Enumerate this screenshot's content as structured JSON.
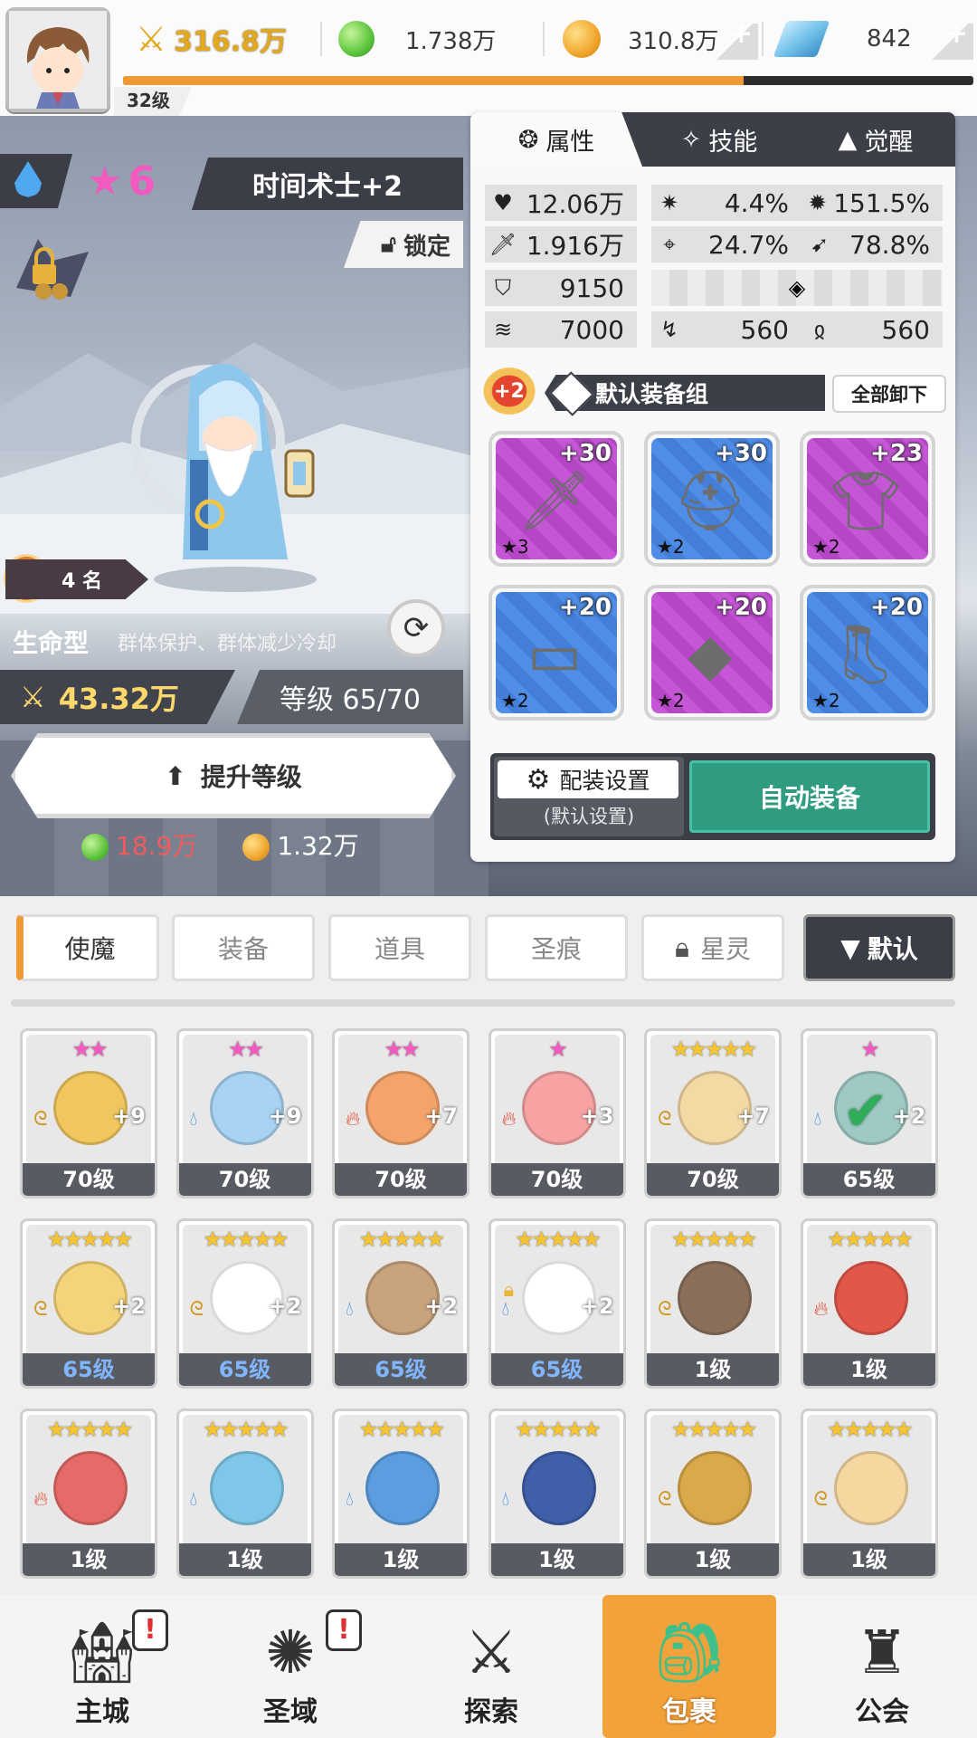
{
  "header": {
    "power": "316.8万",
    "green_currency": "1.738万",
    "gold_currency": "310.8万",
    "gem_currency": "842",
    "player_level": "32级",
    "xp_progress": 0.73
  },
  "hero": {
    "stars": "6",
    "name": "时间术士+2",
    "lock_label": "锁定",
    "hot_icon": "热",
    "hot_rank": "4 名",
    "type": "生命型",
    "type_desc": "群体保护、群体减少冷却",
    "power": "43.32万",
    "level": "等级 65/70",
    "upgrade_label": "提升等级",
    "cost_green": "18.9万",
    "cost_gold": "1.32万"
  },
  "panel": {
    "tabs": [
      "属性",
      "技能",
      "觉醒"
    ],
    "stats": {
      "hp": "12.06万",
      "crit": "4.4%",
      "crit_dmg": "151.5%",
      "atk": "1.916万",
      "acc": "24.7%",
      "dodge": "78.8%",
      "def": "9150",
      "spd": "7000",
      "res1": "560",
      "res2": "560"
    },
    "equip_plus": "+2",
    "equip_set_name": "默认装备组",
    "unequip_label": "全部卸下",
    "equipment": [
      {
        "level": "+30",
        "stars": "★3",
        "rarity": "purple",
        "icon": "sword-icon"
      },
      {
        "level": "+30",
        "stars": "★2",
        "rarity": "blue",
        "icon": "helmet-icon"
      },
      {
        "level": "+23",
        "stars": "★2",
        "rarity": "purple",
        "icon": "armor-icon"
      },
      {
        "level": "+20",
        "stars": "★2",
        "rarity": "blue",
        "icon": "belt-icon"
      },
      {
        "level": "+20",
        "stars": "★2",
        "rarity": "purple",
        "icon": "necklace-icon"
      },
      {
        "level": "+20",
        "stars": "★2",
        "rarity": "blue",
        "icon": "boots-icon"
      }
    ],
    "loadout_label": "配装设置",
    "loadout_sub": "(默认设置)",
    "auto_equip_label": "自动装备"
  },
  "inventory": {
    "tabs": [
      "使魔",
      "装备",
      "道具",
      "圣痕",
      "星灵"
    ],
    "sort_label": "默认",
    "heroes": [
      {
        "stars": "★★",
        "level": "70级",
        "plus": "+9",
        "elem": "wind"
      },
      {
        "stars": "★★",
        "level": "70级",
        "plus": "+9",
        "elem": "water"
      },
      {
        "stars": "★★",
        "level": "70级",
        "plus": "+7",
        "elem": "fire"
      },
      {
        "stars": "★",
        "level": "70级",
        "plus": "+3",
        "elem": "fire"
      },
      {
        "stars": "★★★★★",
        "level": "70级",
        "plus": "+7",
        "elem": "wind"
      },
      {
        "stars": "★",
        "level": "65级",
        "plus": "+2",
        "elem": "water"
      },
      {
        "stars": "★★★★★",
        "level": "65级",
        "plus": "+2",
        "elem": "wind"
      },
      {
        "stars": "★★★★★",
        "level": "65级",
        "plus": "+2",
        "elem": "wind"
      },
      {
        "stars": "★★★★★",
        "level": "65级",
        "plus": "+2",
        "elem": "water"
      },
      {
        "stars": "★★★★★",
        "level": "65级",
        "plus": "+2",
        "elem": "water"
      },
      {
        "stars": "★★★★★",
        "level": "1级",
        "plus": "",
        "elem": "wind"
      },
      {
        "stars": "★★★★★",
        "level": "1级",
        "plus": "",
        "elem": "fire"
      },
      {
        "stars": "★★★★★",
        "level": "1级",
        "plus": "",
        "elem": "fire"
      },
      {
        "stars": "★★★★★",
        "level": "1级",
        "plus": "",
        "elem": "water"
      },
      {
        "stars": "★★★★★",
        "level": "1级",
        "plus": "",
        "elem": "water"
      },
      {
        "stars": "★★★★★",
        "level": "1级",
        "plus": "",
        "elem": "water"
      },
      {
        "stars": "★★★★★",
        "level": "1级",
        "plus": "",
        "elem": "wind"
      },
      {
        "stars": "★★★★★",
        "level": "1级",
        "plus": "",
        "elem": "wind"
      }
    ]
  },
  "nav": {
    "items": [
      "主城",
      "圣域",
      "探索",
      "包裹",
      "公会"
    ],
    "alert": "!"
  },
  "colors": {
    "accent_orange": "#f09a36",
    "star_pink": "#f25ac0",
    "auto_equip_green": "#2f9c82"
  }
}
